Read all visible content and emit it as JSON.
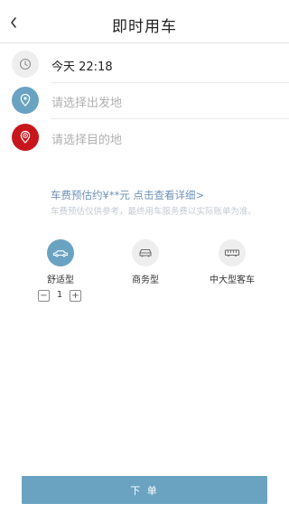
{
  "header": {
    "title": "即时用车",
    "back_icon": "chevron-left-icon"
  },
  "trip": {
    "time": {
      "icon": "clock-icon",
      "value": "今天 22:18"
    },
    "pickup": {
      "icon": "location-pin-icon",
      "placeholder": "请选择出发地",
      "color": "#6aa3c2"
    },
    "destination": {
      "icon": "target-pin-icon",
      "placeholder": "请选择目的地",
      "color": "#c8161d"
    }
  },
  "fare": {
    "estimate_link": "车费预估约¥**元 点击查看详细>",
    "note": "车费预估仅供参考，最终用车服务费以实际账单为准。"
  },
  "car_types": [
    {
      "label": "舒适型",
      "icon": "sedan-icon",
      "selected": true
    },
    {
      "label": "商务型",
      "icon": "car-icon",
      "selected": false
    },
    {
      "label": "中大型客车",
      "icon": "bus-icon",
      "selected": false
    }
  ],
  "quantity": {
    "minus": "−",
    "value": "1",
    "plus": "+"
  },
  "submit": {
    "label": "下 单"
  },
  "colors": {
    "accent": "#6aa3c2",
    "destination": "#c8161d",
    "link": "#6f93b8",
    "icon_bg": "#eeeeee"
  }
}
